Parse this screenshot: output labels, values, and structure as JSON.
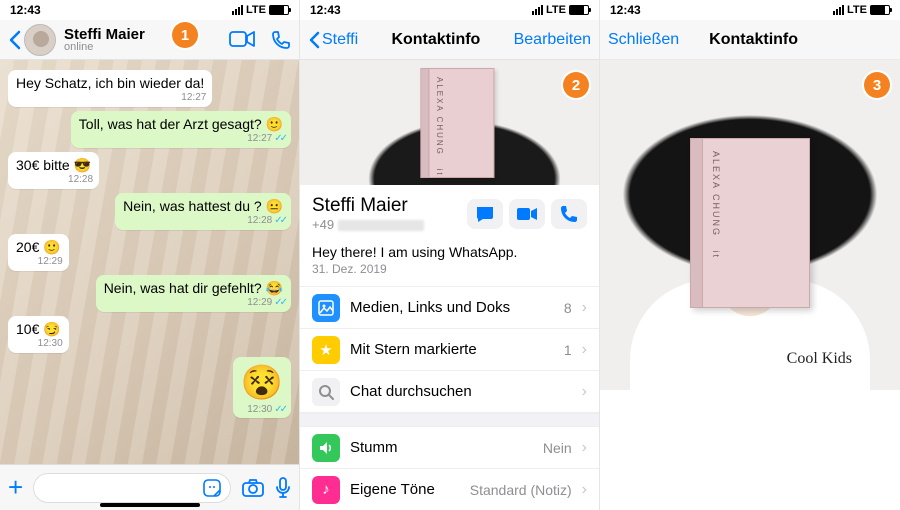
{
  "status": {
    "time": "12:43",
    "net": "LTE"
  },
  "screen1": {
    "contact_name": "Steffi  Maier",
    "contact_status": "online",
    "messages": [
      {
        "dir": "in",
        "text": "Hey Schatz, ich bin wieder da!",
        "time": "12:27",
        "emoji": ""
      },
      {
        "dir": "out",
        "text": "Toll, was hat der Arzt gesagt? ",
        "time": "12:27",
        "emoji": "🙂"
      },
      {
        "dir": "in",
        "text": "30€ bitte ",
        "time": "12:28",
        "emoji": "😎"
      },
      {
        "dir": "out",
        "text": "Nein, was hattest du ? ",
        "time": "12:28",
        "emoji": "😐"
      },
      {
        "dir": "in",
        "text": "20€ ",
        "time": "12:29",
        "emoji": "🙂"
      },
      {
        "dir": "out",
        "text": "Nein, was hat dir gefehlt? ",
        "time": "12:29",
        "emoji": "😂"
      },
      {
        "dir": "in",
        "text": "10€ ",
        "time": "12:30",
        "emoji": "😏"
      },
      {
        "dir": "out",
        "text": "",
        "time": "12:30",
        "emoji": "😵"
      }
    ]
  },
  "screen2": {
    "back": "Steffi",
    "title": "Kontaktinfo",
    "edit": "Bearbeiten",
    "name": "Steffi  Maier",
    "phone_prefix": "+49",
    "about_text": "Hey there! I am using WhatsApp.",
    "about_date": "31. Dez. 2019",
    "rows": {
      "media": {
        "label": "Medien, Links und Doks",
        "value": "8"
      },
      "star": {
        "label": "Mit Stern markierte",
        "value": "1"
      },
      "search": {
        "label": "Chat durchsuchen",
        "value": ""
      },
      "mute": {
        "label": "Stumm",
        "value": "Nein"
      },
      "tone": {
        "label": "Eigene Töne",
        "value": "Standard (Notiz)"
      }
    }
  },
  "screen3": {
    "close": "Schließen",
    "title": "Kontaktinfo",
    "shirt_text": "Cool Kids"
  },
  "badges": {
    "b1": "1",
    "b2": "2",
    "b3": "3"
  }
}
